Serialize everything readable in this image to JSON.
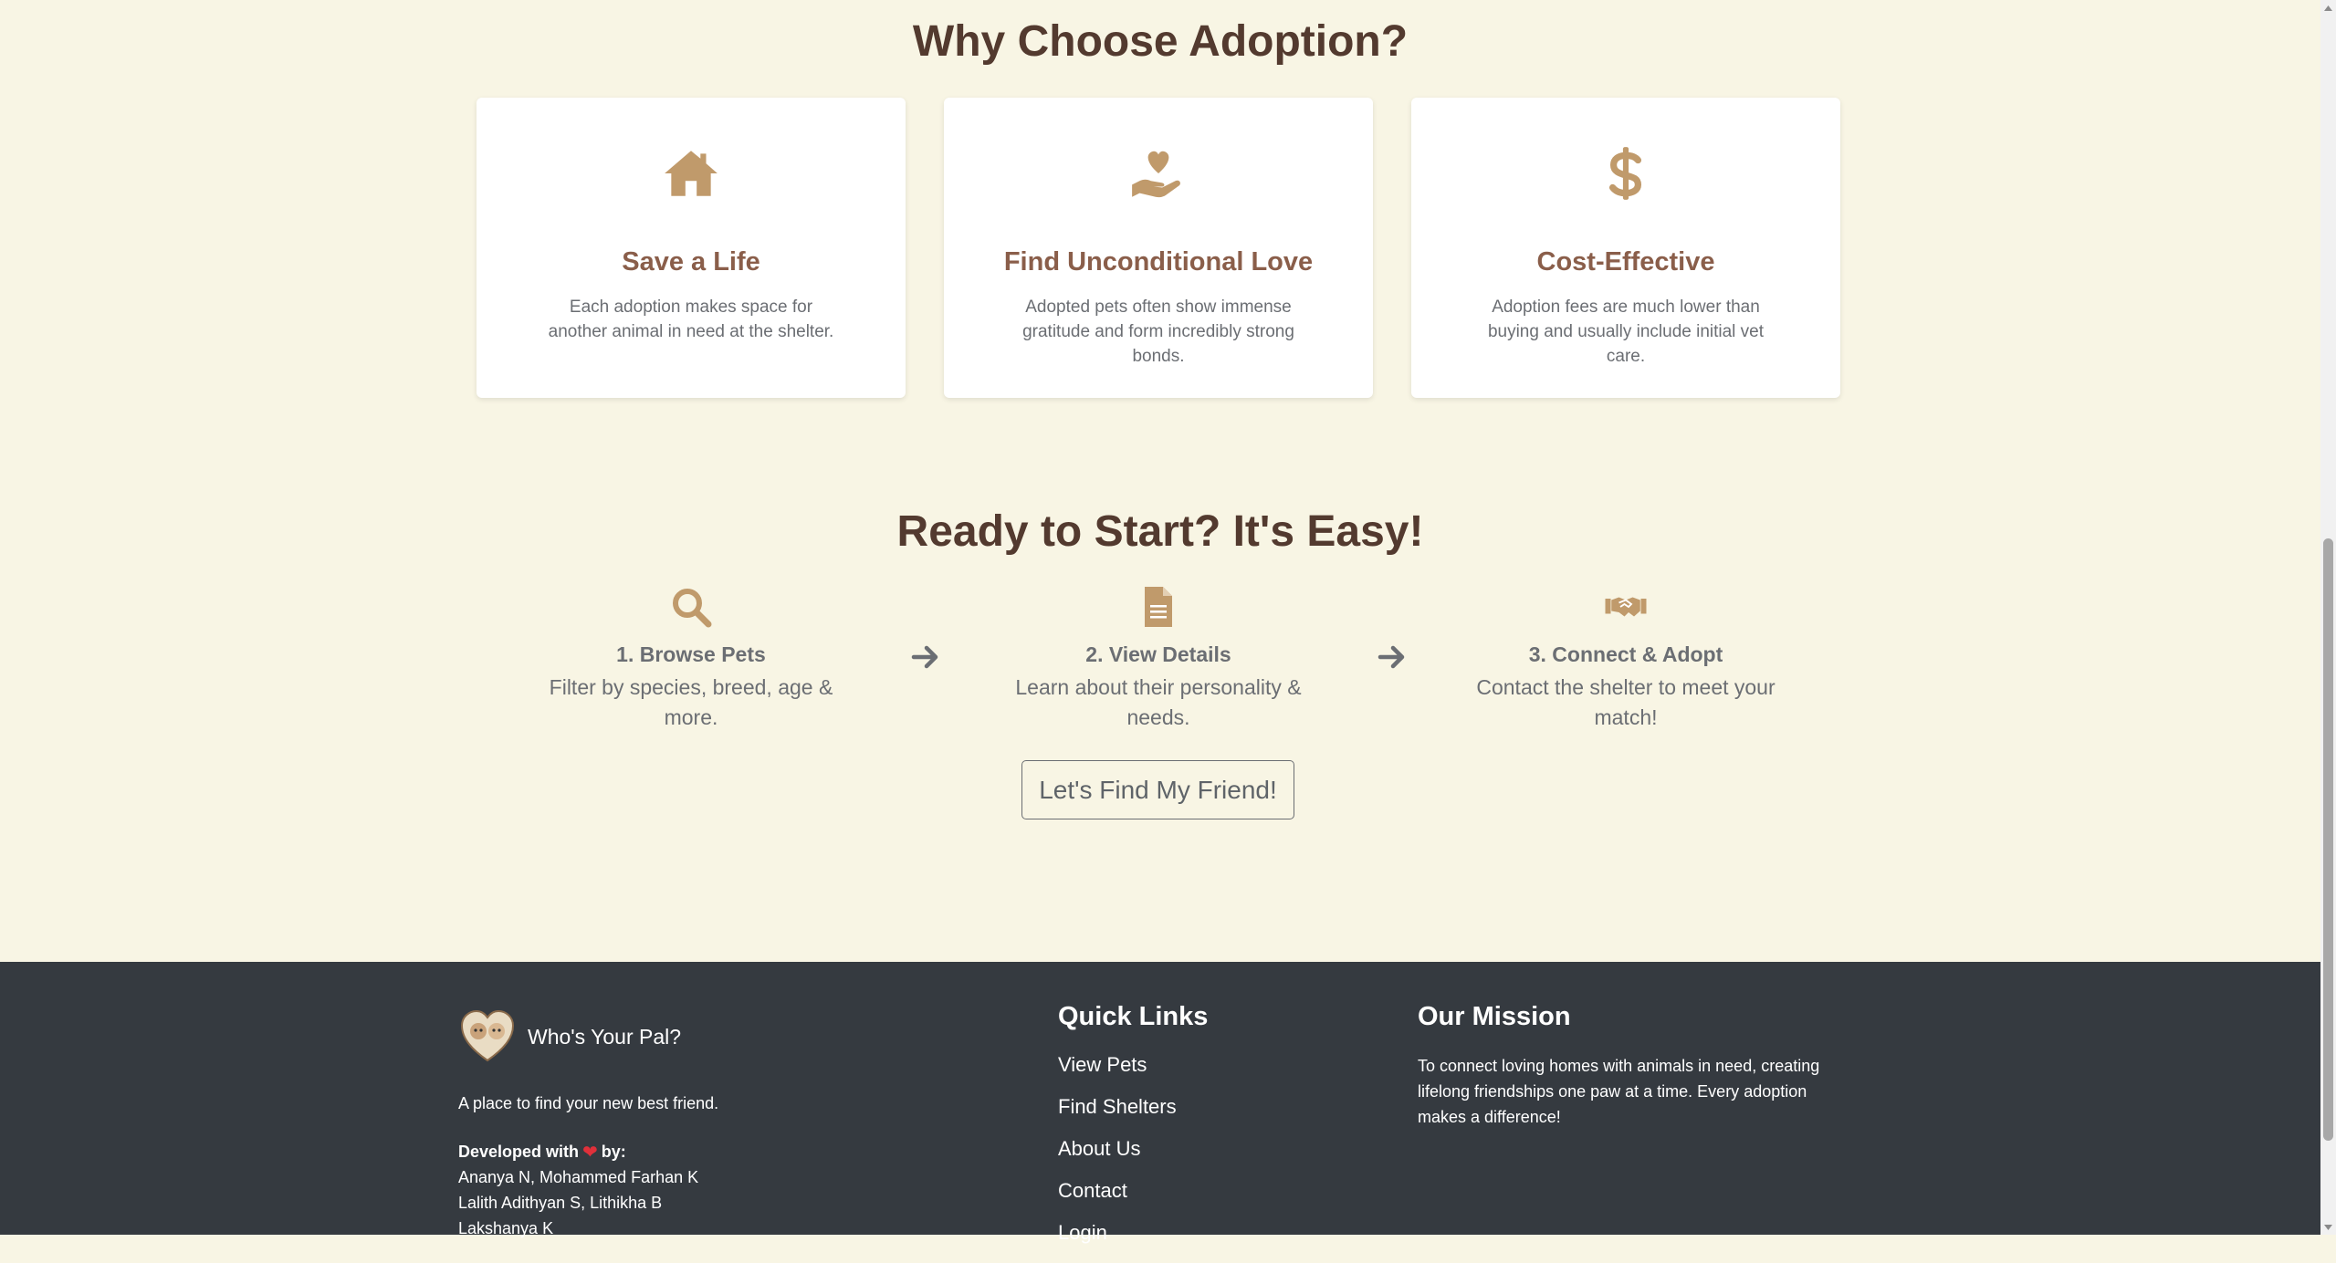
{
  "why": {
    "title": "Why Choose Adoption?",
    "cards": [
      {
        "icon": "home-icon",
        "title": "Save a Life",
        "text": "Each adoption makes space for another animal in need at the shelter."
      },
      {
        "icon": "hand-holding-heart-icon",
        "title": "Find Unconditional Love",
        "text": "Adopted pets often show immense gratitude and form incredibly strong bonds."
      },
      {
        "icon": "dollar-icon",
        "title": "Cost-Effective",
        "text": "Adoption fees are much lower than buying and usually include initial vet care."
      }
    ]
  },
  "ready": {
    "title": "Ready to Start? It's Easy!",
    "steps": [
      {
        "icon": "search-icon",
        "title": "1. Browse Pets",
        "text": "Filter by species, breed, age & more."
      },
      {
        "icon": "document-icon",
        "title": "2. View Details",
        "text": "Learn about their personality & needs."
      },
      {
        "icon": "handshake-icon",
        "title": "3. Connect & Adopt",
        "text": "Contact the shelter to meet your match!"
      }
    ],
    "cta_label": "Let's Find My Friend!"
  },
  "footer": {
    "brand": "Who's Your Pal?",
    "tagline": "A place to find your new best friend.",
    "developed_prefix": "Developed with",
    "developed_suffix": "by:",
    "developers": [
      "Ananya N, Mohammed Farhan K",
      "Lalith Adithyan S, Lithikha B",
      "Lakshanya K"
    ],
    "quick_links_title": "Quick Links",
    "quick_links": [
      "View Pets",
      "Find Shelters",
      "About Us",
      "Contact",
      "Login"
    ],
    "mission_title": "Our Mission",
    "mission_text": "To connect loving homes with animals in need, creating lifelong friendships one paw at a time. Every adoption makes a difference!"
  },
  "colors": {
    "background": "#f8f5e4",
    "accent": "#c09a6b",
    "heading": "#533a2f",
    "card_title": "#8a5e4a",
    "footer_bg": "#353a40",
    "heart": "#e0303a"
  }
}
